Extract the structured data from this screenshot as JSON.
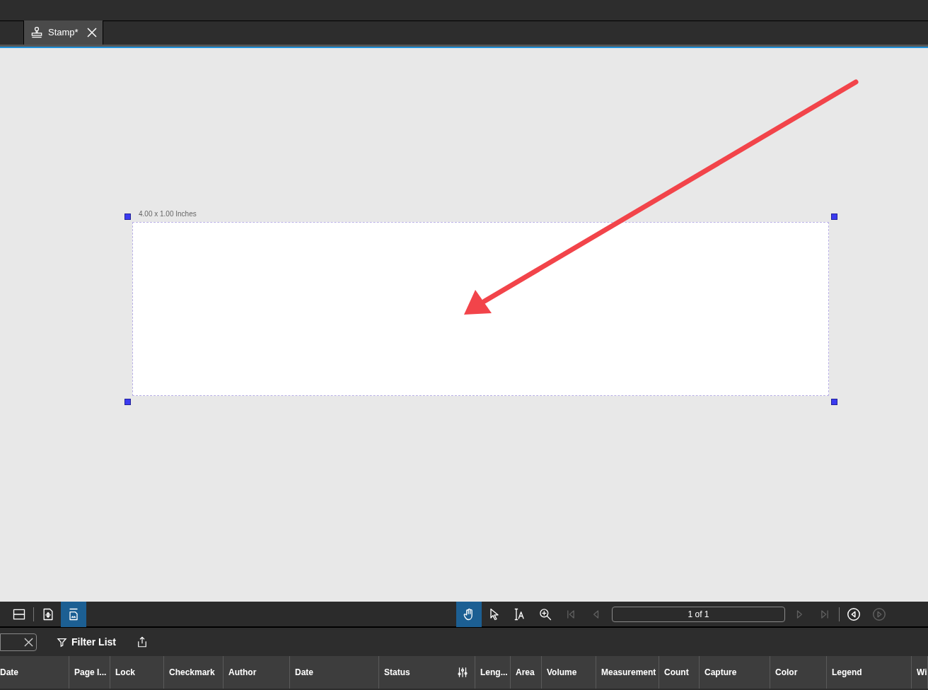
{
  "tabs": [
    {
      "label": "Stamp*",
      "selected": true
    }
  ],
  "canvas": {
    "dimension_label": "4.00 x 1.00 Inches"
  },
  "left_tools": [
    {
      "kind": "rows",
      "selected": false
    },
    {
      "kind": "page-move",
      "selected": false
    },
    {
      "kind": "crop",
      "selected": true
    }
  ],
  "nav_tools": [
    {
      "kind": "hand",
      "selected": true,
      "disabled": false
    },
    {
      "kind": "pointer",
      "selected": false,
      "disabled": false
    },
    {
      "kind": "text-select",
      "selected": false,
      "disabled": false
    },
    {
      "kind": "zoom",
      "selected": false,
      "disabled": false
    },
    {
      "kind": "first",
      "selected": false,
      "disabled": true
    },
    {
      "kind": "prev",
      "selected": false,
      "disabled": true
    }
  ],
  "page_field": {
    "value": "1 of 1"
  },
  "after_tools": [
    {
      "kind": "next",
      "selected": false,
      "disabled": true
    },
    {
      "kind": "last",
      "selected": false,
      "disabled": true
    }
  ],
  "history_tools": [
    {
      "kind": "back",
      "selected": false,
      "disabled": false
    },
    {
      "kind": "forward",
      "selected": false,
      "disabled": true
    }
  ],
  "filter_button": {
    "label": "Filter List"
  },
  "table": {
    "columns": [
      "Date",
      "Page I...",
      "Lock",
      "Checkmark",
      "Author",
      "Date",
      "Status",
      "Leng...",
      "Area",
      "Volume",
      "Measurement",
      "Count",
      "Capture",
      "Color",
      "Legend",
      "Wi"
    ]
  }
}
